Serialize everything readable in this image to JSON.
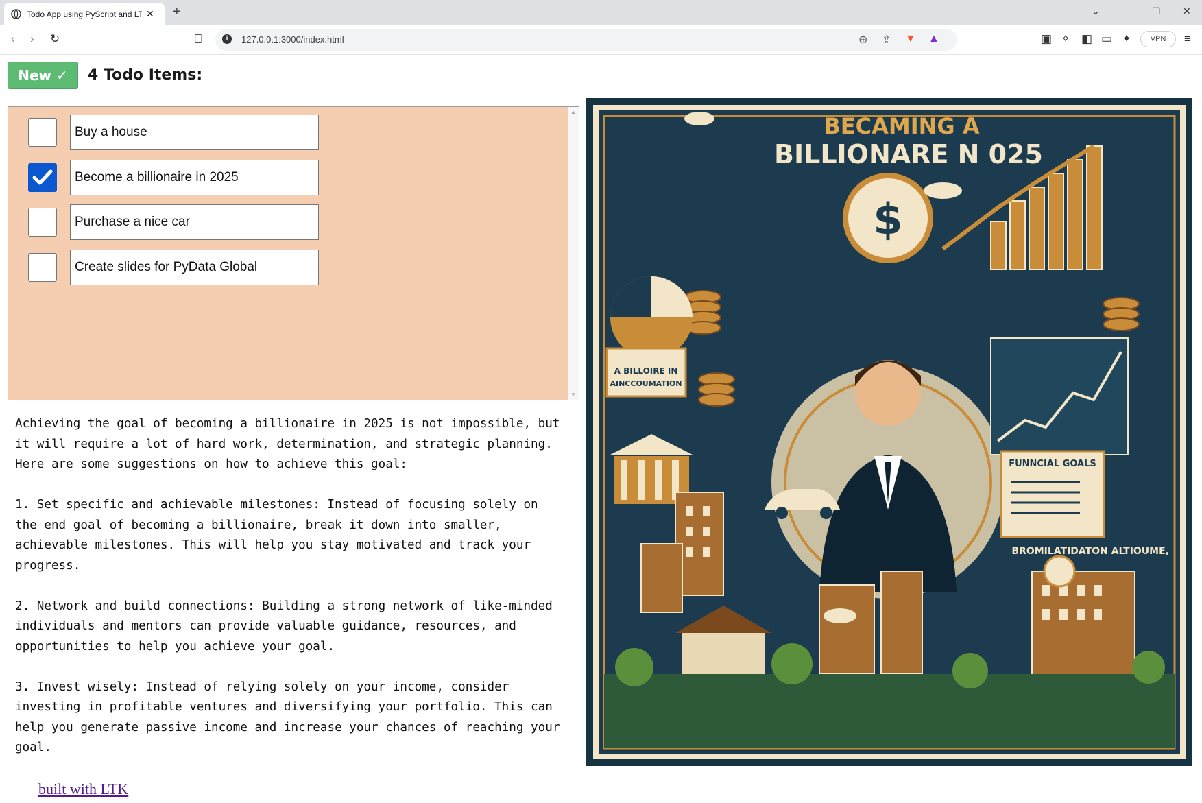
{
  "browser": {
    "tab_title": "Todo App using PyScript and LTK",
    "url": "127.0.0.1:3000/index.html",
    "vpn_label": "VPN"
  },
  "toolbar": {
    "new_button_label": "New ✓",
    "items_title": "4 Todo Items:"
  },
  "todos": [
    {
      "text": "Buy a house",
      "checked": false
    },
    {
      "text": "Become a billionaire in 2025",
      "checked": true
    },
    {
      "text": "Purchase a nice car",
      "checked": false
    },
    {
      "text": "Create slides for PyData Global",
      "checked": false
    }
  ],
  "advice": "Achieving the goal of becoming a billionaire in 2025 is not impossible, but\nit will require a lot of hard work, determination, and strategic planning.\nHere are some suggestions on how to achieve this goal:\n\n1. Set specific and achievable milestones: Instead of focusing solely on\nthe end goal of becoming a billionaire, break it down into smaller,\nachievable milestones. This will help you stay motivated and track your\nprogress.\n\n2. Network and build connections: Building a strong network of like-minded\nindividuals and mentors can provide valuable guidance, resources, and\nopportunities to help you achieve your goal.\n\n3. Invest wisely: Instead of relying solely on your income, consider\ninvesting in profitable ventures and diversifying your portfolio. This can\nhelp you generate passive income and increase your chances of reaching your\ngoal.",
  "footer": {
    "link_text": "built with LTK"
  },
  "illustration": {
    "headline_line1": "BECAMING A",
    "headline_line2": "BILLIONARE N 025",
    "label_financial_goals": "FUNNCIAL GOALS",
    "label_bottom_right": "BROMILATIDATON ALTIOUME,",
    "label_left_mid": "A BILLOIRE IN",
    "label_left_mid2": "AINCCOUMATION",
    "colors": {
      "background": "#163344",
      "gold": "#c98d3a",
      "cream": "#f3e6c8",
      "brown": "#7a4a1e"
    }
  },
  "colors": {
    "todo_panel_bg": "#f5cdb0",
    "new_button_bg": "#5dbb74",
    "checkbox_checked": "#0b57d0",
    "link": "#551a8b"
  }
}
